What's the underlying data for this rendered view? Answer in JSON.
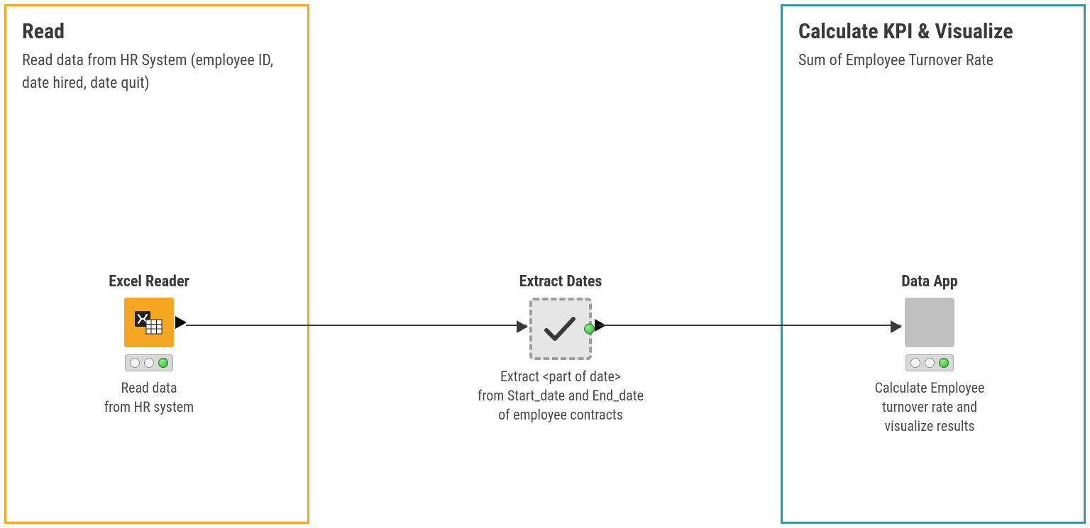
{
  "annotations": {
    "left": {
      "title": "Read",
      "description": "Read data from HR System (employee ID, date hired, date quit)"
    },
    "right": {
      "title": "Calculate KPI & Visualize",
      "description": "Sum of Employee Turnover Rate"
    }
  },
  "nodes": {
    "excel": {
      "label": "Excel Reader",
      "desc_line1": "Read data",
      "desc_line2": "from HR system",
      "icon": "excel-reader-icon"
    },
    "extract": {
      "label": "Extract Dates",
      "desc_line1": "Extract <part of date>",
      "desc_line2": "from Start_date and End_date",
      "desc_line3": "of employee contracts",
      "icon": "metanode-icon"
    },
    "app": {
      "label": "Data App",
      "desc_line1": "Calculate Employee",
      "desc_line2": "turnover rate and",
      "desc_line3": "visualize results",
      "icon": "component-icon"
    }
  },
  "traffic_states": {
    "excel": "green",
    "app": "green"
  }
}
